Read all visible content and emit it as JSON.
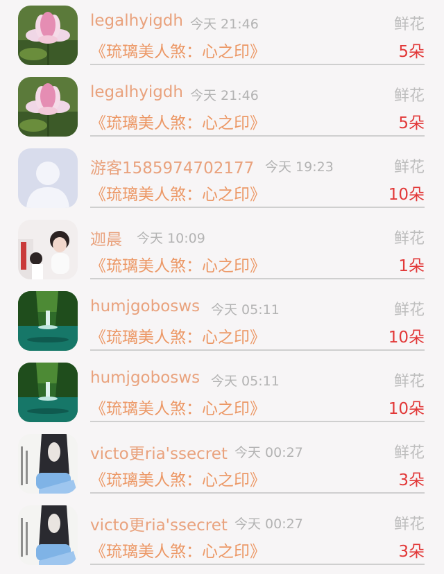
{
  "gifts": [
    {
      "avatar": "lotus-avatar",
      "user": "legalhyigdh",
      "time": "今天 21:46",
      "gift_type": "鲜花",
      "work": "《琉璃美人煞：心之印》",
      "count": "5朵"
    },
    {
      "avatar": "lotus-avatar",
      "user": "legalhyigdh",
      "time": "今天 21:46",
      "gift_type": "鲜花",
      "work": "《琉璃美人煞：心之印》",
      "count": "5朵"
    },
    {
      "avatar": "default-guest-avatar",
      "user": "游客1585974702177",
      "time": "今天 19:23",
      "gift_type": "鲜花",
      "work": "《琉璃美人煞：心之印》",
      "count": "10朵"
    },
    {
      "avatar": "photo-avatar",
      "user": "迦晨",
      "time": "今天 10:09",
      "gift_type": "鲜花",
      "work": "《琉璃美人煞：心之印》",
      "count": "1朵"
    },
    {
      "avatar": "waterfall-avatar",
      "user": "humjgobosws",
      "time": "今天 05:11",
      "gift_type": "鲜花",
      "work": "《琉璃美人煞：心之印》",
      "count": "10朵"
    },
    {
      "avatar": "waterfall-avatar",
      "user": "humjgobosws",
      "time": "今天 05:11",
      "gift_type": "鲜花",
      "work": "《琉璃美人煞：心之印》",
      "count": "10朵"
    },
    {
      "avatar": "calligraphy-photo-avatar",
      "user": "victo更ria'ssecret",
      "time": "今天 00:27",
      "gift_type": "鲜花",
      "work": "《琉璃美人煞：心之印》",
      "count": "3朵"
    },
    {
      "avatar": "calligraphy-photo-avatar",
      "user": "victo更ria'ssecret",
      "time": "今天 00:27",
      "gift_type": "鲜花",
      "work": "《琉璃美人煞：心之印》",
      "count": "3朵"
    }
  ]
}
